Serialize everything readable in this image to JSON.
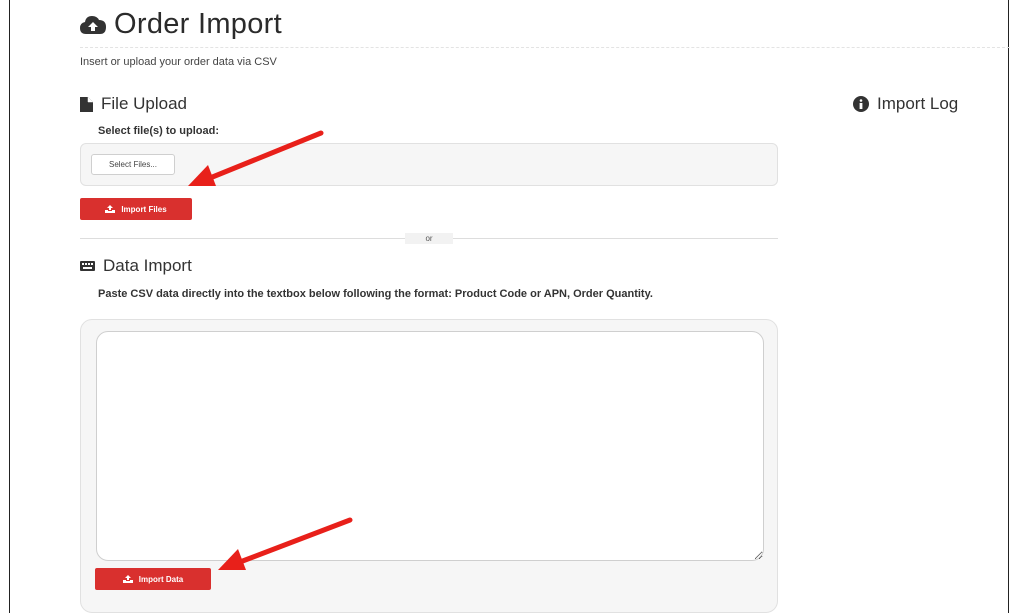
{
  "header": {
    "title": "Order Import",
    "subtitle": "Insert or upload your order data via CSV",
    "icon": "cloud-upload-icon"
  },
  "file_upload": {
    "heading": "File Upload",
    "heading_icon": "file-icon",
    "select_label": "Select file(s) to upload:",
    "select_button": "Select Files...",
    "import_button": "Import Files",
    "import_button_icon": "upload-icon"
  },
  "divider": {
    "text": "or"
  },
  "data_import": {
    "heading": "Data Import",
    "heading_icon": "keyboard-icon",
    "description": "Paste CSV data directly into the textbox below following the format: Product Code or APN, Order Quantity.",
    "textarea_value": "",
    "import_button": "Import Data",
    "import_button_icon": "upload-icon"
  },
  "import_log": {
    "heading": "Import Log",
    "heading_icon": "info-circle-icon"
  },
  "colors": {
    "accent": "#d9302e",
    "annotation_arrow": "#e8201a"
  }
}
